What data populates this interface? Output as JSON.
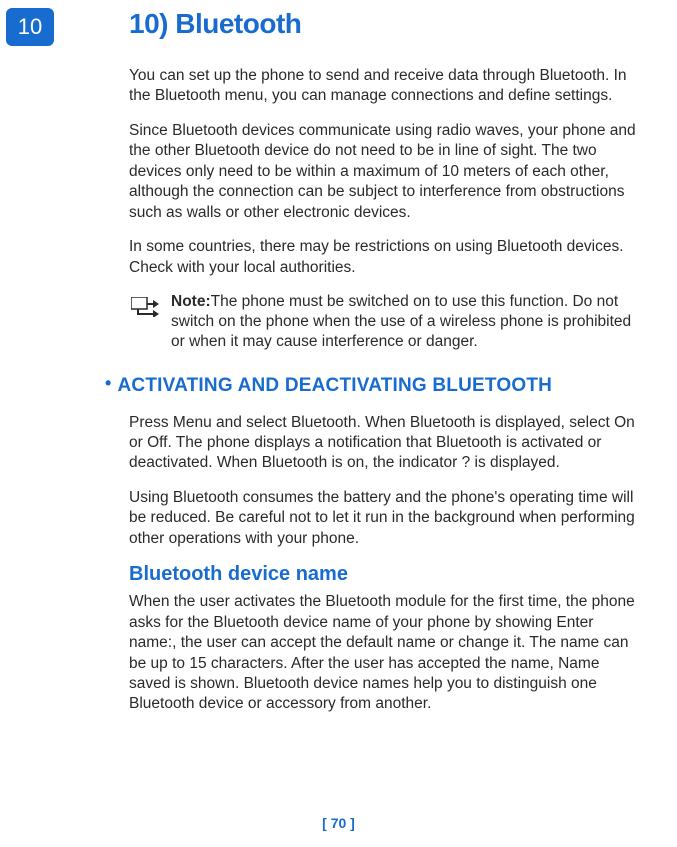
{
  "tab": {
    "number": "10"
  },
  "chapter": {
    "title": "10) Bluetooth"
  },
  "intro": {
    "p1": "You can set up the phone to send and receive data through Bluetooth. In the Bluetooth menu, you can manage connections and define settings.",
    "p2": "Since Bluetooth devices communicate using radio waves, your phone and the other Bluetooth device do not need to be in line of sight. The two devices only need to be within a maximum of 10 meters of each other, although the connection can be subject to interference from obstructions such as walls or other electronic devices.",
    "p3": "In some countries, there may be restrictions on using Bluetooth devices. Check with your local authorities."
  },
  "note": {
    "label": "Note:",
    "text": "The phone must be switched on to use this function. Do not switch on the phone when the use of a wireless phone is prohibited or when it may cause interference or danger."
  },
  "section1": {
    "heading": "ACTIVATING AND DEACTIVATING BLUETOOTH",
    "p1": "Press Menu and select Bluetooth. When Bluetooth is displayed, select On or Off. The phone displays a notification that Bluetooth is activated or deactivated. When Bluetooth is on, the indicator ? is displayed.",
    "p2": "Using Bluetooth consumes the battery and the phone's operating time will be reduced. Be careful not to let it run in the background when performing other operations with your phone."
  },
  "section2": {
    "heading": "Bluetooth device name",
    "p1": "When the user activates the Bluetooth module for the first time, the phone asks for the Bluetooth device name of your phone by showing Enter name:, the user can accept the default name or change it. The name can be up to 15 characters. After the user has accepted the name, Name saved is shown. Bluetooth device names help you to distinguish one Bluetooth device or accessory from another."
  },
  "footer": {
    "page": "[ 70 ]"
  }
}
